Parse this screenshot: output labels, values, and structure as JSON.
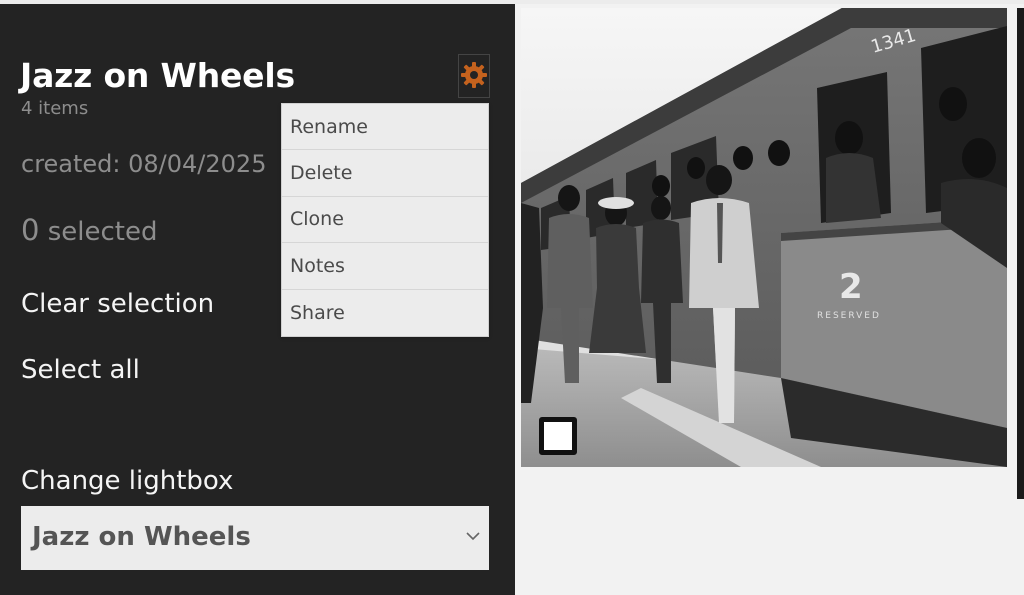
{
  "lightbox": {
    "title": "Jazz on Wheels",
    "item_count": "4 items",
    "created": "created: 08/04/2025",
    "selected_count": "0",
    "selected_suffix": " selected",
    "clear_selection": "Clear selection",
    "select_all": "Select all",
    "change_lightbox_label": "Change lightbox",
    "change_lightbox_value": "Jazz on Wheels"
  },
  "menu": {
    "items": [
      {
        "label": "Rename"
      },
      {
        "label": "Delete"
      },
      {
        "label": "Clone"
      },
      {
        "label": "Notes"
      },
      {
        "label": "Share"
      }
    ]
  },
  "photo": {
    "carriage_number": "1341",
    "coach_class": "2",
    "reserved_text": "RESERVED"
  },
  "icons": {
    "settings": "gear-icon",
    "dropdown": "chevron-down-icon",
    "select": "checkbox-icon"
  },
  "colors": {
    "sidebar_bg": "#232323",
    "gear_accent": "#c4621e",
    "menu_bg": "#ececec",
    "select_bg": "#ececec"
  }
}
